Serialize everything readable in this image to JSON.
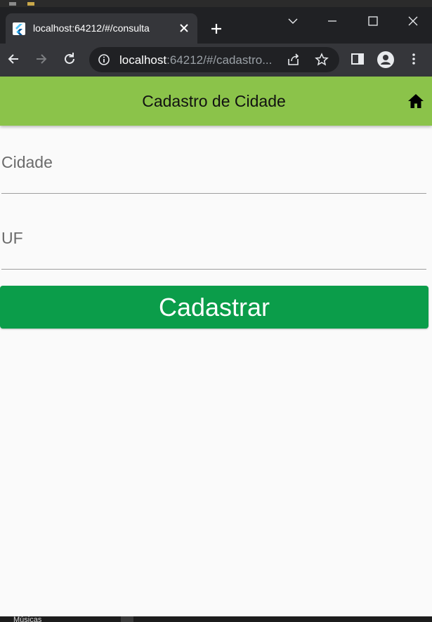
{
  "browser": {
    "tab": {
      "title": "localhost:64212/#/consulta",
      "favicon": "flutter-icon"
    },
    "address": {
      "host": "localhost",
      "rest": ":64212/#/cadastro..."
    },
    "icons": [
      "back-icon",
      "forward-icon",
      "reload-icon",
      "info-icon",
      "share-icon",
      "star-icon",
      "sidepanel-icon",
      "profile-icon",
      "menu-icon",
      "minimize-icon",
      "maximize-icon",
      "close-icon",
      "new-tab-icon"
    ]
  },
  "app": {
    "title": "Cadastro de Cidade",
    "home_icon": "home-icon",
    "fields": {
      "cidade": {
        "label": "Cidade",
        "value": ""
      },
      "uf": {
        "label": "UF",
        "value": ""
      }
    },
    "submit_label": "Cadastrar",
    "colors": {
      "appbar": "#8bc34a",
      "button": "#0b9d4a",
      "background": "#fafafa"
    }
  },
  "taskbar": {
    "item": "Músicas"
  }
}
